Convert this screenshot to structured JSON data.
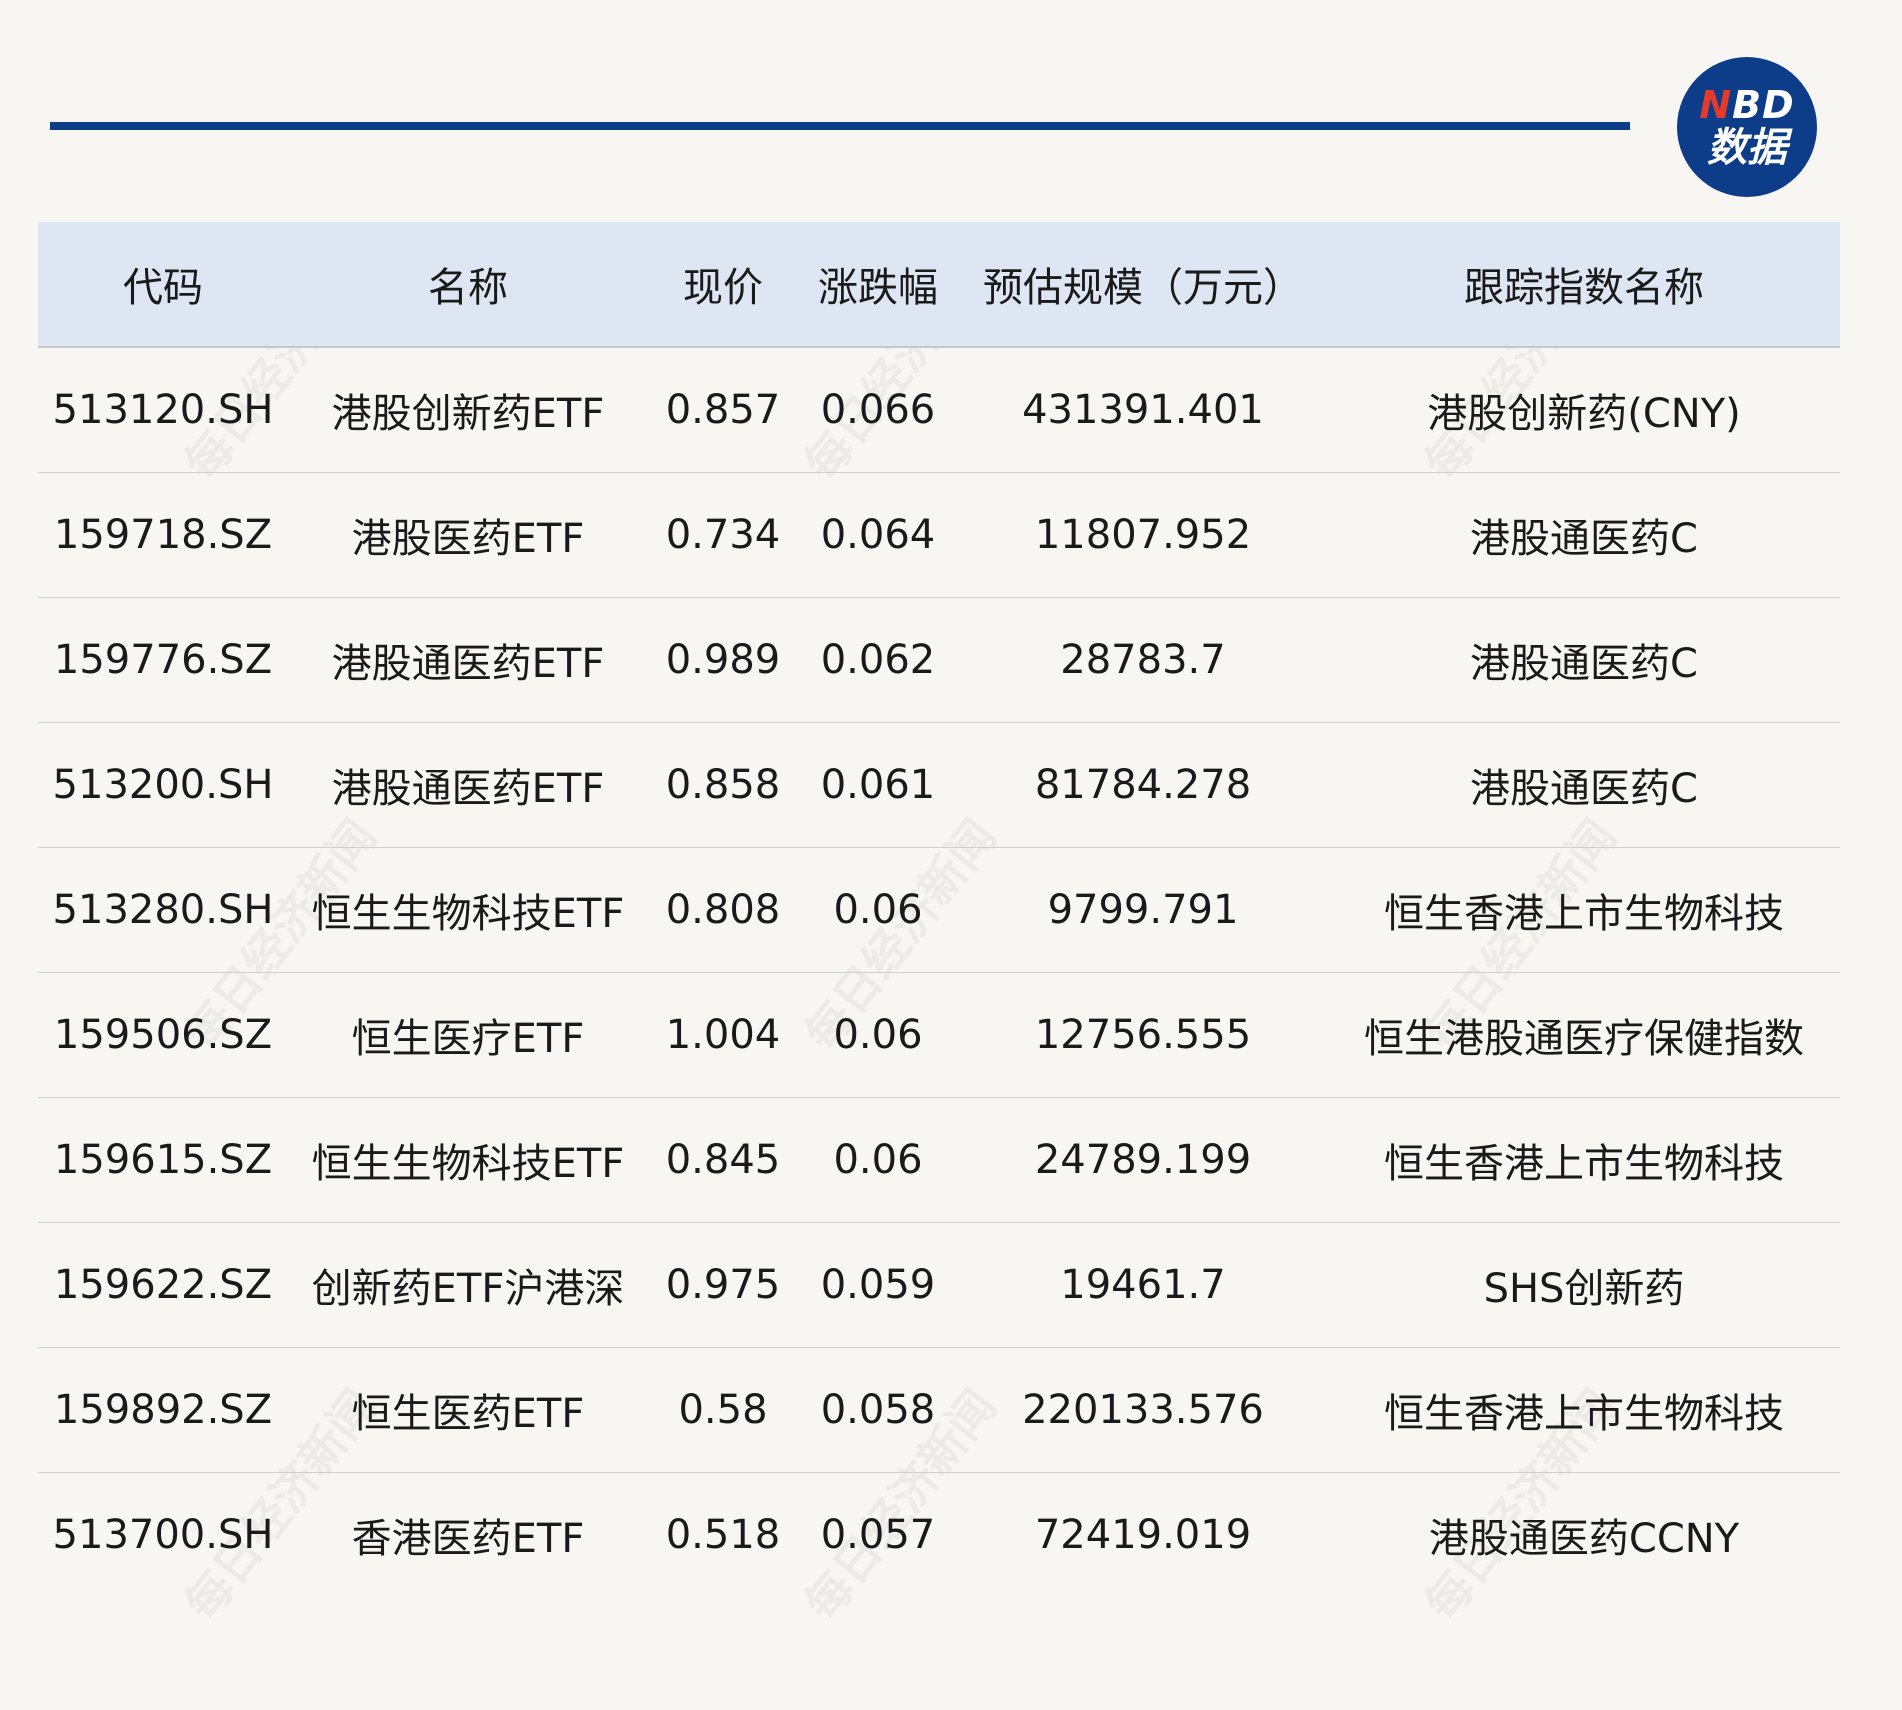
{
  "logo": {
    "line1_n": "N",
    "line1_rest": "BD",
    "line2": "数据"
  },
  "watermark": {
    "text": "每日经济新闻"
  },
  "table": {
    "headers": [
      "代码",
      "名称",
      "现价",
      "涨跌幅",
      "预估规模（万元）",
      "跟踪指数名称"
    ],
    "rows": [
      [
        "513120.SH",
        "港股创新药ETF",
        "0.857",
        "0.066",
        "431391.401",
        "港股创新药(CNY)"
      ],
      [
        "159718.SZ",
        "港股医药ETF",
        "0.734",
        "0.064",
        "11807.952",
        "港股通医药C"
      ],
      [
        "159776.SZ",
        "港股通医药ETF",
        "0.989",
        "0.062",
        "28783.7",
        "港股通医药C"
      ],
      [
        "513200.SH",
        "港股通医药ETF",
        "0.858",
        "0.061",
        "81784.278",
        "港股通医药C"
      ],
      [
        "513280.SH",
        "恒生生物科技ETF",
        "0.808",
        "0.06",
        "9799.791",
        "恒生香港上市生物科技"
      ],
      [
        "159506.SZ",
        "恒生医疗ETF",
        "1.004",
        "0.06",
        "12756.555",
        "恒生港股通医疗保健指数"
      ],
      [
        "159615.SZ",
        "恒生生物科技ETF",
        "0.845",
        "0.06",
        "24789.199",
        "恒生香港上市生物科技"
      ],
      [
        "159622.SZ",
        "创新药ETF沪港深",
        "0.975",
        "0.059",
        "19461.7",
        "SHS创新药"
      ],
      [
        "159892.SZ",
        "恒生医药ETF",
        "0.58",
        "0.058",
        "220133.576",
        "恒生香港上市生物科技"
      ],
      [
        "513700.SH",
        "香港医药ETF",
        "0.518",
        "0.057",
        "72419.019",
        "港股通医药CCNY"
      ]
    ]
  }
}
